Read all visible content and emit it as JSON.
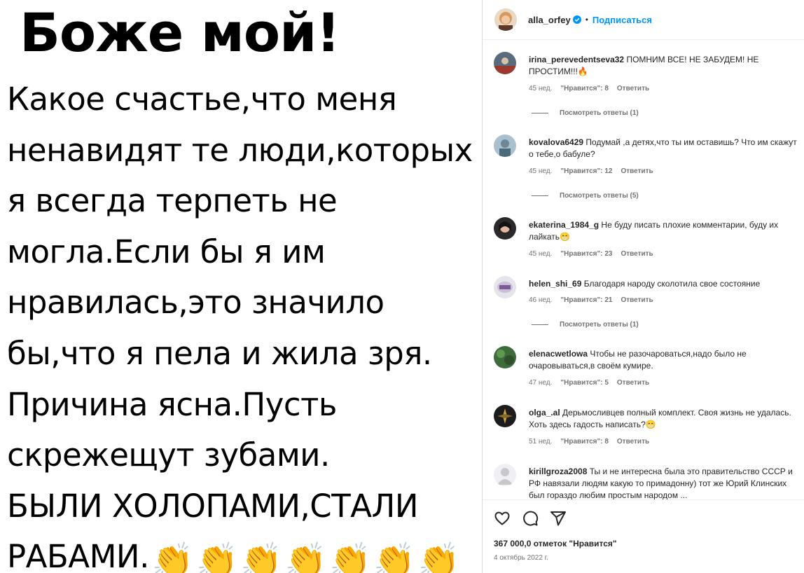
{
  "post": {
    "title": "Боже мой!",
    "lines": [
      "Какое счастье,что меня",
      "ненавидят те люди,которых",
      "я всегда терпеть не",
      "могла.Если бы я им",
      "нравилась,это значило",
      "бы,что я пела и жила зря.",
      "Причина ясна.Пусть",
      "скрежещут зубами.",
      "БЫЛИ ХОЛОПАМИ,СТАЛИ"
    ],
    "last_line": "РАБАМИ.",
    "clap_emoji": "👏"
  },
  "header": {
    "username": "alla_orfey",
    "dot": "•",
    "follow_label": "Подписаться",
    "verified_color": "#0095f6"
  },
  "comments": [
    {
      "user": "irina_perevedentseva32",
      "text": "ПОМНИМ ВСЕ! НЕ ЗАБУДЕМ! НЕ ПРОСТИМ!!!🔥",
      "time": "45 нед.",
      "likes": "\"Нравится\": 8",
      "reply": "Ответить",
      "view_replies": "Посмотреть ответы (1)",
      "avatar_color": "#5a6b7d"
    },
    {
      "user": "kovalova6429",
      "text": "Подумай ,а детях,что ты им оставишь? Что им скажут о тебе,о бабуле?",
      "time": "45 нед.",
      "likes": "\"Нравится\": 12",
      "reply": "Ответить",
      "view_replies": "Посмотреть ответы (5)",
      "avatar_color": "#8aa3b5"
    },
    {
      "user": "ekaterina_1984_g",
      "text": "Не буду писать плохие комментарии, буду их лайкать😁",
      "time": "45 нед.",
      "likes": "\"Нравится\": 23",
      "reply": "Ответить",
      "view_replies": "",
      "avatar_color": "#2a2a2a"
    },
    {
      "user": "helen_shi_69",
      "text": "Благодаря народу сколотила свое состояние",
      "time": "46 нед.",
      "likes": "\"Нравится\": 21",
      "reply": "Ответить",
      "view_replies": "Посмотреть ответы (1)",
      "avatar_color": "#d8d8e0"
    },
    {
      "user": "elenacwetlowa",
      "text": "Чтобы не разочароваться,надо было не очаровываться,в своём кумире.",
      "time": "47 нед.",
      "likes": "\"Нравится\": 5",
      "reply": "Ответить",
      "view_replies": "",
      "avatar_color": "#3d6b3a"
    },
    {
      "user": "olga_.al",
      "text": "Дерьмосливцев полный комплект. Своя жизнь не удалась. Хоть здесь гадость написать?😁",
      "time": "51 нед.",
      "likes": "\"Нравится\": 8",
      "reply": "Ответить",
      "view_replies": "",
      "avatar_color": "#1c1c1c"
    },
    {
      "user": "kirillgroza2008",
      "text": "Ты и не интересна была это правительство СССР и РФ навязали людям какую то примадонну) тот же Юрий Клинских был гораздо любим простым народом ...",
      "time": "",
      "likes": "",
      "reply": "",
      "view_replies": "",
      "avatar_color": "#c7c7cc"
    }
  ],
  "footer": {
    "likes_count": "367 000,0 отметок \"Нравится\"",
    "date": "4 октябрь 2022 г."
  }
}
